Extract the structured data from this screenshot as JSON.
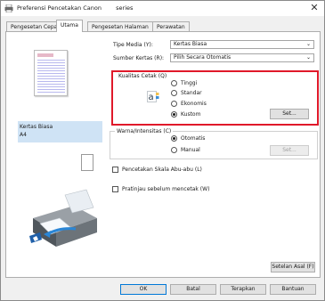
{
  "window": {
    "title": "Preferensi Pencetakan Canon",
    "title_suffix": "series",
    "close_glyph": "✕",
    "app_icon": "printer-icon",
    "close_icon": "close-icon"
  },
  "tabs": [
    {
      "label": "Pengesetan Cepat",
      "active": false
    },
    {
      "label": "Utama",
      "active": true
    },
    {
      "label": "Pengesetan Halaman",
      "active": false
    },
    {
      "label": "Perawatan",
      "active": false
    }
  ],
  "preview": {
    "media_name": "Kertas Biasa",
    "paper_size": "A4"
  },
  "media_type": {
    "label": "Tipe Media (Y):",
    "value": "Kertas Biasa"
  },
  "paper_source": {
    "label": "Sumber Kertas (R):",
    "value": "Pilih Secara Otomatis"
  },
  "print_quality": {
    "legend": "Kualitas Cetak (Q)",
    "options": [
      {
        "label": "Tinggi",
        "selected": false
      },
      {
        "label": "Standar",
        "selected": false
      },
      {
        "label": "Ekonomis",
        "selected": false
      },
      {
        "label": "Kustom",
        "selected": true
      }
    ],
    "set_button": "Set...",
    "quality_icon": "quality-a-icon"
  },
  "color_intensity": {
    "legend": "Warna/Intensitas (C)",
    "options": [
      {
        "label": "Otomatis",
        "selected": true
      },
      {
        "label": "Manual",
        "selected": false
      }
    ],
    "set_button": "Set..."
  },
  "grayscale": {
    "label": "Pencetakan Skala Abu-abu (L)",
    "checked": false
  },
  "preview_before_print": {
    "label": "Pratinjau sebelum mencetak (W)",
    "checked": false
  },
  "buttons": {
    "defaults": "Setelan Asal (F)",
    "ok": "OK",
    "cancel": "Batal",
    "apply": "Terapkan",
    "help": "Bantuan"
  },
  "colors": {
    "highlight_box": "#e0192a",
    "selected_info": "#cfe3f5",
    "accent": "#0078d7"
  }
}
